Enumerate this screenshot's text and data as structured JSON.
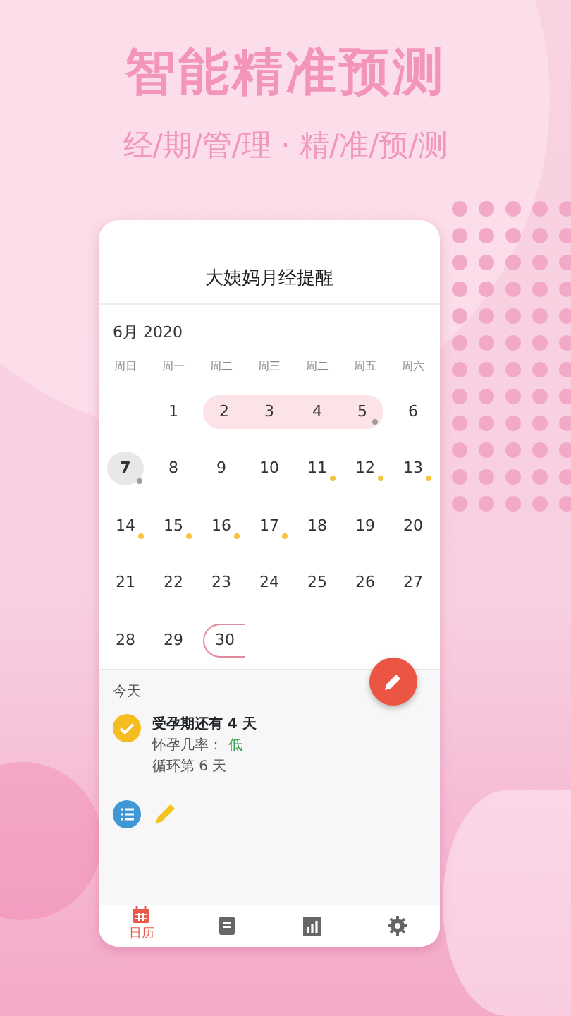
{
  "headline": "智能精准预测",
  "tagline": "经/期/管/理 · 精/准/预/测",
  "app": {
    "title": "大姨妈月经提醒",
    "month": "6月 2020",
    "weekdays": [
      "周日",
      "周一",
      "周二",
      "周三",
      "周二",
      "周五",
      "周六"
    ],
    "days": [
      {
        "kind": "empty"
      },
      {
        "label": "1",
        "kind": "normal"
      },
      {
        "label": "2",
        "kind": "period-start"
      },
      {
        "label": "3",
        "kind": "period"
      },
      {
        "label": "4",
        "kind": "period"
      },
      {
        "label": "5",
        "kind": "period-end",
        "color": "#9e9e9e"
      },
      {
        "label": "6",
        "kind": "normal"
      },
      {
        "label": "7",
        "kind": "today",
        "color": "#9e9e9e"
      },
      {
        "label": "8",
        "kind": "normal"
      },
      {
        "label": "9",
        "kind": "normal"
      },
      {
        "label": "10",
        "kind": "normal"
      },
      {
        "label": "11",
        "kind": "normal",
        "color": "#f5c342"
      },
      {
        "label": "12",
        "kind": "normal",
        "color": "#f5c342"
      },
      {
        "label": "13",
        "kind": "normal",
        "color": "#f5c342"
      },
      {
        "label": "14",
        "kind": "normal",
        "color": "#f5c342"
      },
      {
        "label": "15",
        "kind": "normal",
        "color": "#f5c342"
      },
      {
        "label": "16",
        "kind": "normal",
        "color": "#f5c342"
      },
      {
        "label": "17",
        "kind": "normal",
        "color": "#f5c342"
      },
      {
        "label": "18",
        "kind": "normal"
      },
      {
        "label": "19",
        "kind": "normal"
      },
      {
        "label": "20",
        "kind": "normal"
      },
      {
        "label": "21",
        "kind": "normal"
      },
      {
        "label": "22",
        "kind": "normal"
      },
      {
        "label": "23",
        "kind": "normal"
      },
      {
        "label": "24",
        "kind": "normal"
      },
      {
        "label": "25",
        "kind": "normal"
      },
      {
        "label": "26",
        "kind": "normal"
      },
      {
        "label": "27",
        "kind": "normal"
      },
      {
        "label": "28",
        "kind": "normal"
      },
      {
        "label": "29",
        "kind": "normal"
      },
      {
        "label": "30",
        "kind": "predicted"
      }
    ],
    "today_label": "今天",
    "status": {
      "title": "受孕期还有 4 天",
      "chance_label": "怀孕几率：",
      "chance": "低",
      "cycle": "循环第 6 天"
    },
    "nav": [
      {
        "kind": "calendar",
        "label": "日历",
        "selected": true
      },
      {
        "kind": "notes",
        "selected": false
      },
      {
        "kind": "chart",
        "selected": false
      },
      {
        "kind": "settings",
        "selected": false
      }
    ]
  }
}
